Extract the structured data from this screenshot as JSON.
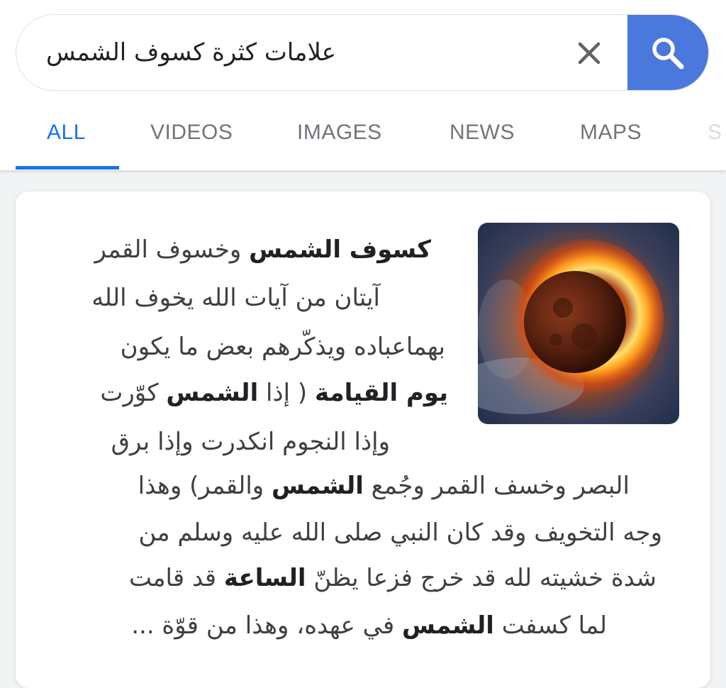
{
  "search": {
    "query": "علامات كثرة كسوف الشمس",
    "clear_icon": "close-icon",
    "submit_icon": "search-icon"
  },
  "tabs": [
    {
      "label": "ALL",
      "active": true
    },
    {
      "label": "VIDEOS",
      "active": false
    },
    {
      "label": "IMAGES",
      "active": false
    },
    {
      "label": "NEWS",
      "active": false
    },
    {
      "label": "MAPS",
      "active": false
    },
    {
      "label": "S",
      "active": false
    }
  ],
  "result": {
    "image_alt": "solar-eclipse-image",
    "lines": [
      [
        {
          "t": "كسوف الشمس",
          "b": true
        },
        {
          "t": " وخسوف القمر",
          "b": false
        }
      ],
      [
        {
          "t": "آيتان من آيات الله يخوف الله",
          "b": false
        }
      ],
      [
        {
          "t": "بهماعباده ويذكّرهم بعض ما يكون",
          "b": false
        }
      ],
      [
        {
          "t": "يوم القيامة",
          "b": true
        },
        {
          "t": " ( إذا ",
          "b": false
        },
        {
          "t": "الشمس",
          "b": true
        },
        {
          "t": " كوّرت",
          "b": false
        }
      ],
      [
        {
          "t": "وإذا النجوم انكدرت وإذا برق",
          "b": false
        }
      ],
      [
        {
          "t": "البصر وخسف القمر وجُمع ",
          "b": false
        },
        {
          "t": "الشمس",
          "b": true
        },
        {
          "t": " والقمر) وهذا",
          "b": false
        }
      ],
      [
        {
          "t": "وجه التخويف وقد كان النبي صلى الله عليه وسلم من",
          "b": false
        }
      ],
      [
        {
          "t": "شدة خشيته لله قد خرج فزعا يظنّ ",
          "b": false
        },
        {
          "t": "الساعة",
          "b": true
        },
        {
          "t": " قد قامت",
          "b": false
        }
      ],
      [
        {
          "t": "لما كسفت ",
          "b": false
        },
        {
          "t": "الشمس",
          "b": true
        },
        {
          "t": " في عهده، وهذا من قوّة ...",
          "b": false
        }
      ]
    ]
  },
  "colors": {
    "accent": "#1a73e8",
    "search_button": "#4a78dc",
    "tab_inactive": "#70757a",
    "text": "#3c4043"
  }
}
